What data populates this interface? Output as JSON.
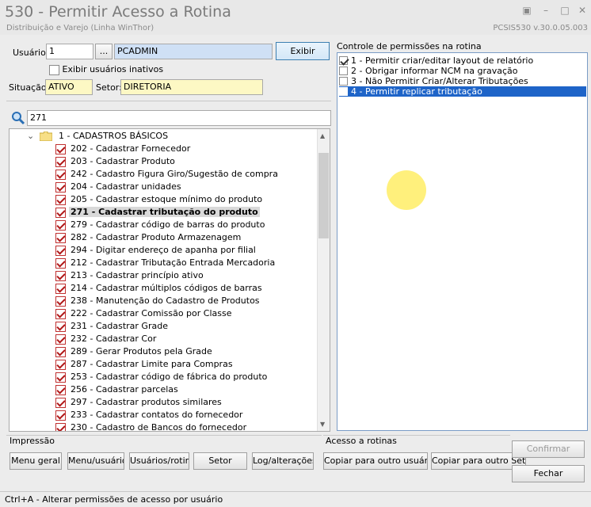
{
  "window": {
    "title": "530 - Permitir Acesso a Rotina",
    "subtitle": "Distribuição e Varejo (Linha WinThor)",
    "version": "PCSIS530  v.30.0.05.003"
  },
  "user": {
    "label": "Usuário:",
    "id_value": "1",
    "lookup_label": "...",
    "name_value": "PCADMIN",
    "show_button": "Exibir",
    "inactive_label": "Exibir usuários inativos",
    "situation_label": "Situação:",
    "situation_value": "ATIVO",
    "sector_label": "Setor:",
    "sector_value": "DIRETORIA"
  },
  "search": {
    "value": "271"
  },
  "tree": {
    "category": "1 - CADASTROS BÁSICOS",
    "items": [
      {
        "label": "202 - Cadastrar  Fornecedor"
      },
      {
        "label": "203 - Cadastrar  Produto"
      },
      {
        "label": "242 - Cadastro Figura Giro/Sugestão de compra"
      },
      {
        "label": "204 - Cadastrar unidades"
      },
      {
        "label": "205 - Cadastrar estoque mínimo do produto"
      },
      {
        "label": "271 - Cadastrar tributação do produto"
      },
      {
        "label": "279 - Cadastrar código de barras do produto"
      },
      {
        "label": "282 - Cadastrar Produto Armazenagem"
      },
      {
        "label": "294 - Digitar endereço de apanha por filial"
      },
      {
        "label": "212 - Cadastrar Tributação Entrada Mercadoria"
      },
      {
        "label": "213 - Cadastrar princípio ativo"
      },
      {
        "label": "214 - Cadastrar múltiplos códigos de barras"
      },
      {
        "label": "238 - Manutenção do Cadastro de Produtos"
      },
      {
        "label": "222 - Cadastrar Comissão por Classe"
      },
      {
        "label": "231 - Cadastrar Grade"
      },
      {
        "label": "232 - Cadastrar Cor"
      },
      {
        "label": "289 - Gerar Produtos pela Grade"
      },
      {
        "label": "287 - Cadastrar Limite para Compras"
      },
      {
        "label": "253 - Cadastrar código de fábrica do produto"
      },
      {
        "label": "256 - Cadastrar parcelas"
      },
      {
        "label": "297 - Cadastrar produtos similares"
      },
      {
        "label": "233 - Cadastrar contatos do fornecedor"
      },
      {
        "label": "230 - Cadastro de Bancos do fornecedor"
      }
    ]
  },
  "permissions": {
    "title": "Controle de permissões na rotina",
    "items": [
      {
        "label": "1 - Permitir criar/editar layout de relatório"
      },
      {
        "label": "2 - Obrigar informar NCM na gravação"
      },
      {
        "label": "3 - Não Permitir Criar/Alterar Tributações"
      },
      {
        "label": "4 - Permitir replicar tributação"
      }
    ]
  },
  "impressao": {
    "title": "Impressão",
    "buttons": [
      "Menu geral",
      "Menu/usuário",
      "Usuários/rotina",
      "Setor",
      "Log/alterações"
    ]
  },
  "acesso": {
    "title": "Acesso a rotinas",
    "copy_user": "Copiar para outro usuário",
    "copy_sector": "Copiar para outro Setor"
  },
  "actions": {
    "confirm": "Confirmar",
    "close": "Fechar"
  },
  "status": {
    "text": "Ctrl+A - Alterar permissões de acesso por usuário"
  }
}
